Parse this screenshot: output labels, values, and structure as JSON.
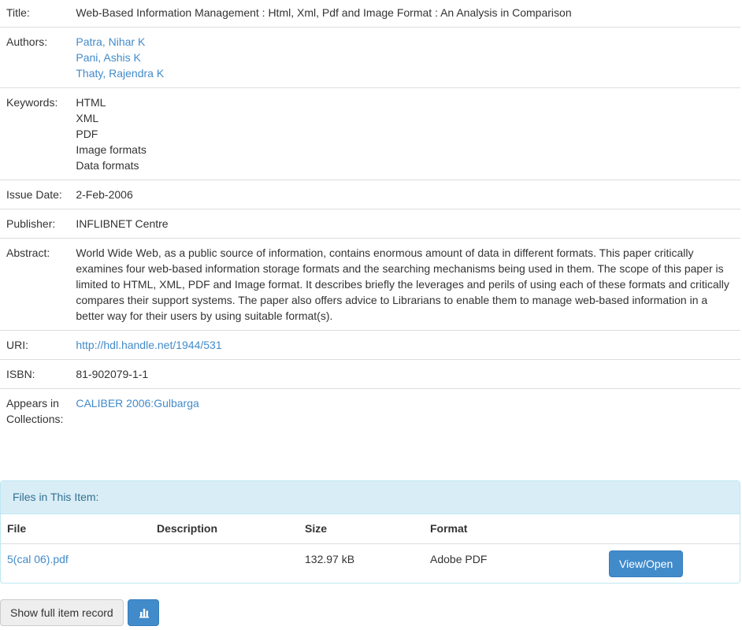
{
  "metadata": {
    "title_label": "Title:",
    "title_value": "Web-Based Information Management : Html, Xml, Pdf and Image Format : An Analysis in Comparison",
    "authors_label": "Authors:",
    "authors": [
      "Patra, Nihar K",
      "Pani, Ashis K",
      "Thaty, Rajendra K"
    ],
    "keywords_label": "Keywords:",
    "keywords": [
      "HTML",
      "XML",
      "PDF",
      "Image formats",
      "Data formats"
    ],
    "issue_date_label": "Issue Date:",
    "issue_date": "2-Feb-2006",
    "publisher_label": "Publisher:",
    "publisher": "INFLIBNET Centre",
    "abstract_label": "Abstract:",
    "abstract": "World Wide Web, as a public source of information, contains enormous amount of data in different formats. This paper critically examines four web-based information storage formats and the searching mechanisms being used in them. The scope of this paper is limited to HTML, XML, PDF and Image format. It describes briefly the leverages and perils of using each of these formats and critically compares their support systems. The paper also offers advice to Librarians to enable them to manage web-based information in a better way for their users by using suitable format(s).",
    "uri_label": "URI:",
    "uri": "http://hdl.handle.net/1944/531",
    "isbn_label": "ISBN:",
    "isbn": "81-902079-1-1",
    "collections_label": "Appears in Collections:",
    "collection": "CALIBER 2006:Gulbarga"
  },
  "files": {
    "heading": "Files in This Item:",
    "columns": [
      "File",
      "Description",
      "Size",
      "Format"
    ],
    "rows": [
      {
        "file": "5(cal 06).pdf",
        "description": "",
        "size": "132.97 kB",
        "format": "Adobe PDF",
        "action": "View/Open"
      }
    ]
  },
  "actions": {
    "show_full_record": "Show full item record",
    "stats_icon": "bar-chart-icon"
  },
  "colors": {
    "link": "#428bca",
    "primary": "#428bca",
    "panel_heading_bg": "#d9edf7",
    "panel_heading_text": "#31708f"
  }
}
